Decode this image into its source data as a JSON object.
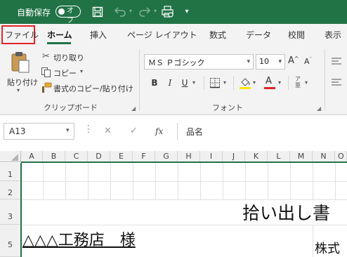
{
  "titlebar": {
    "autosave_label": "自動保存",
    "autosave_state": "オフ",
    "icons": [
      "save-icon",
      "undo-icon",
      "redo-icon",
      "print-preview-icon",
      "customize-qat-icon"
    ]
  },
  "tabs": [
    {
      "label": "ファイル"
    },
    {
      "label": "ホーム"
    },
    {
      "label": "挿入"
    },
    {
      "label": "ページ レイアウト"
    },
    {
      "label": "数式"
    },
    {
      "label": "データ"
    },
    {
      "label": "校閲"
    },
    {
      "label": "表示"
    }
  ],
  "clipboard": {
    "paste_label": "貼り付け",
    "cut_label": "切り取り",
    "copy_label": "コピー",
    "format_painter_label": "書式のコピー/貼り付け",
    "group_label": "クリップボード"
  },
  "font": {
    "name": "ＭＳ Ｐゴシック",
    "size": "10",
    "bold": "B",
    "italic": "I",
    "underline": "U",
    "group_label": "フォント"
  },
  "formula_bar": {
    "name_box": "A13",
    "cancel": "✕",
    "enter": "✓",
    "fx": "fx",
    "content": "品名"
  },
  "columns": [
    "A",
    "B",
    "C",
    "D",
    "E",
    "F",
    "G",
    "H",
    "I",
    "J",
    "K",
    "L",
    "M",
    "N",
    "O"
  ],
  "rows": [
    "1",
    "2",
    "3",
    "5"
  ],
  "cells": {
    "title_fragment": "拾い出し書",
    "client": "△△△工務店　様",
    "company_fragment": "株式"
  },
  "colors": {
    "excel_green": "#217346",
    "highlight_red": "#e0242b",
    "font_color_red": "#e0242b",
    "fill_yellow": "#ffe600"
  }
}
